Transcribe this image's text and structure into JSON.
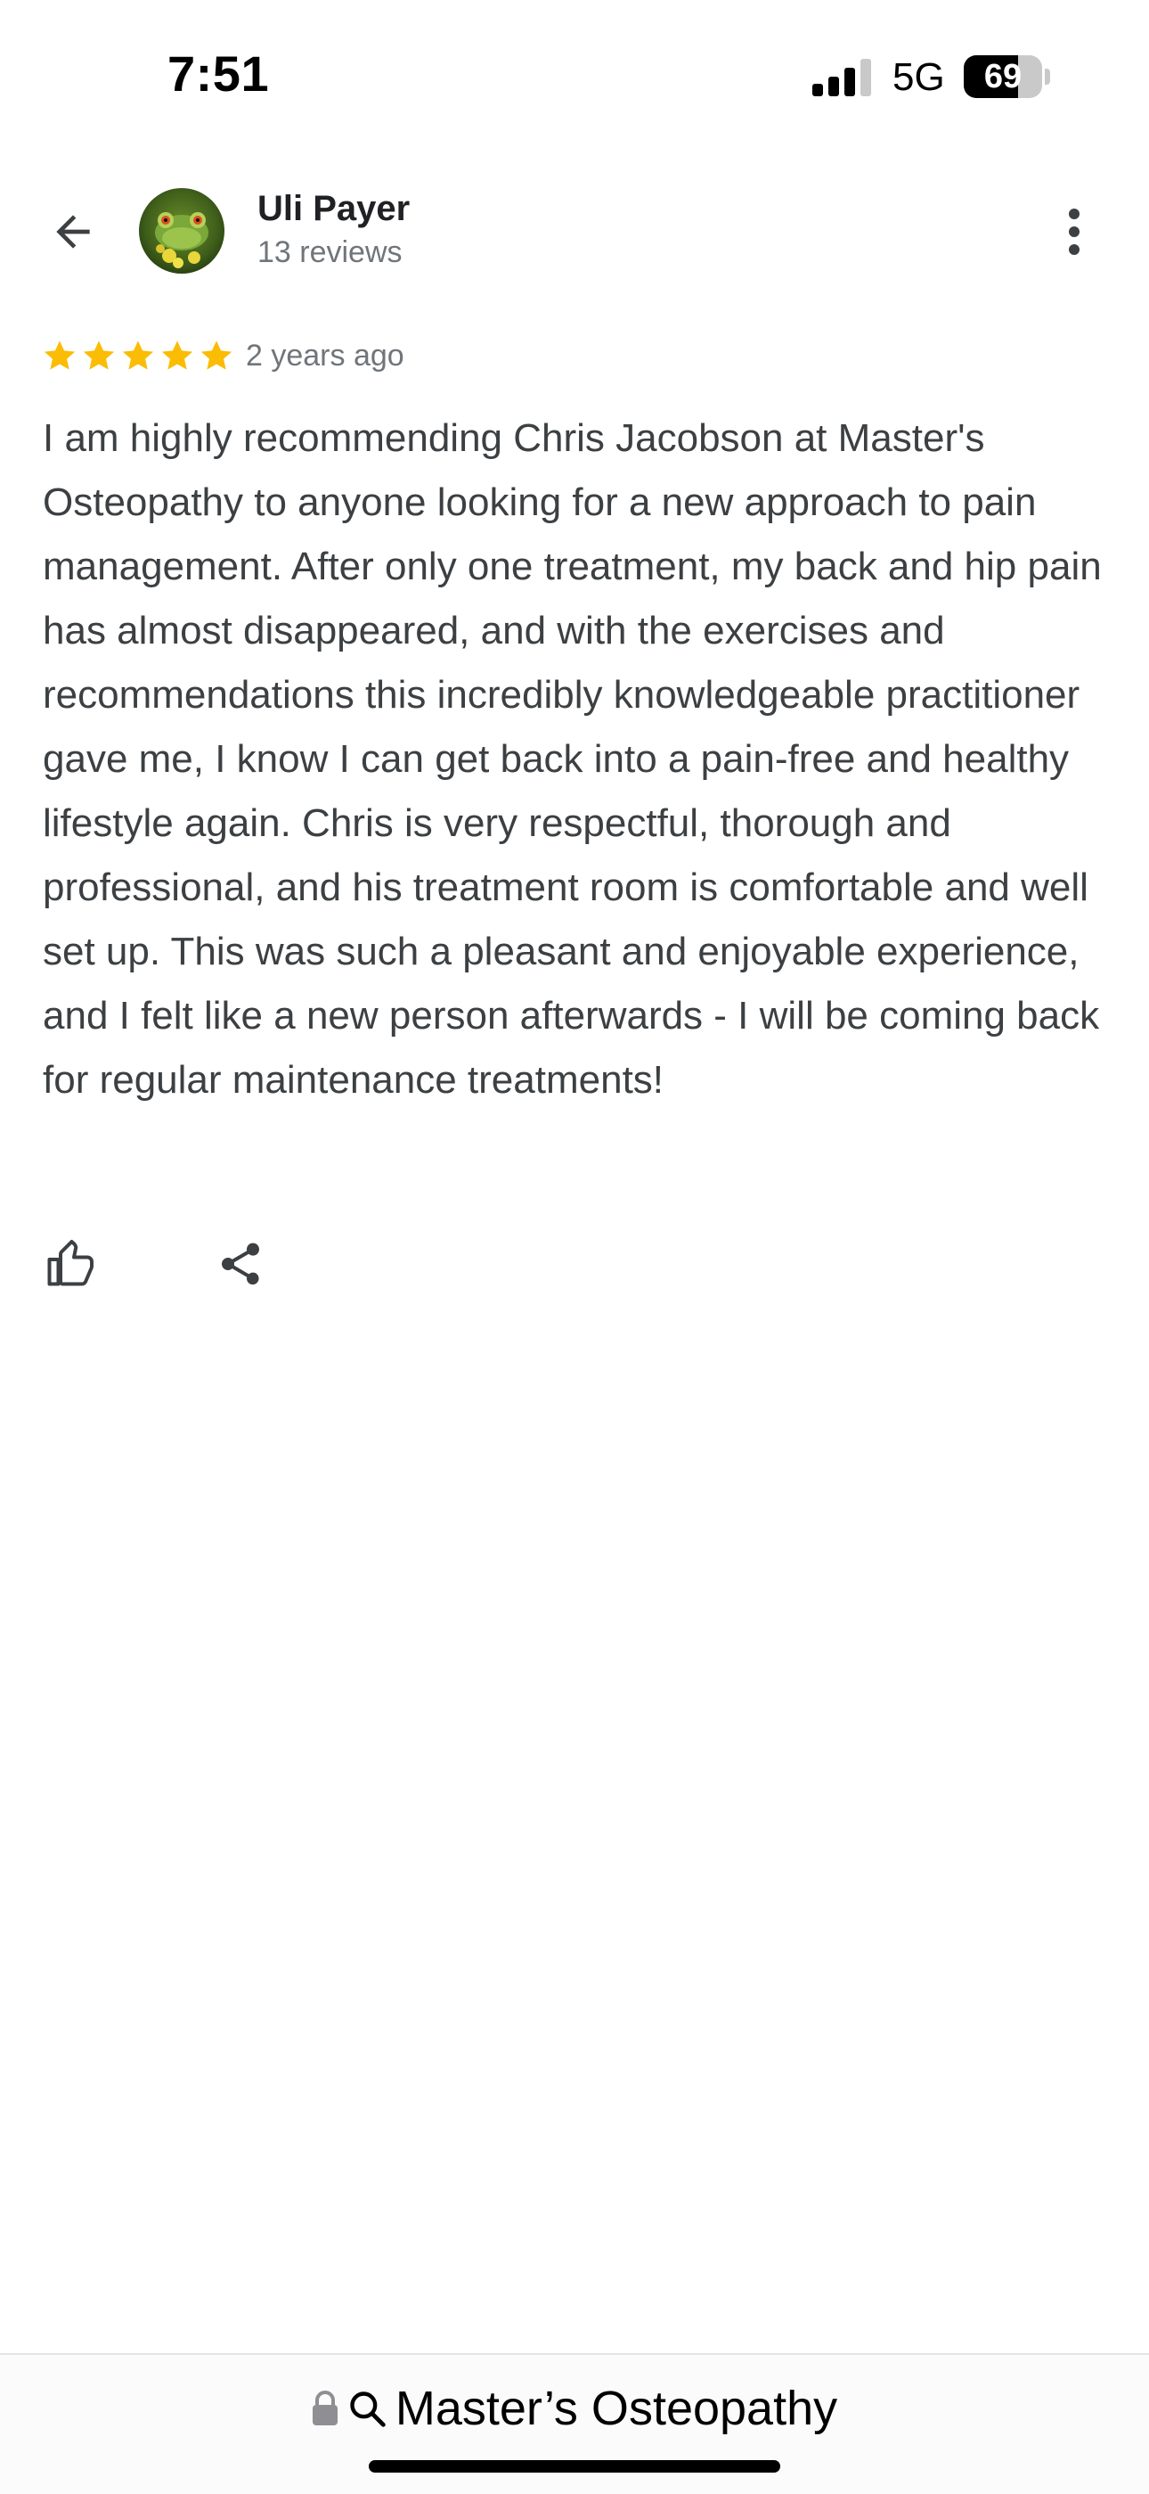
{
  "status_bar": {
    "time": "7:51",
    "network": "5G",
    "battery_level": "69",
    "battery_fraction": 0.69,
    "signal_bars_active": 3,
    "signal_bars_total": 4
  },
  "header": {
    "back_icon": "arrow-left-icon",
    "reviewer_name": "Uli Payer",
    "review_count": "13 reviews",
    "more_icon": "more-vertical-icon"
  },
  "review": {
    "rating": 5,
    "rating_max": 5,
    "date": "2 years ago",
    "text": "I am highly recommending Chris Jacobson at Master's Osteopathy to anyone looking for a new approach to pain management. After only one treatment, my back and hip pain has almost disappeared, and with the exercises and recommendations this incredibly knowledgeable practitioner gave me, I know I can get back into a pain-free and healthy lifestyle again. Chris is very respectful, thorough and professional, and his treatment room is comfortable and well set up. This was such a pleasant and enjoyable experience, and I felt like a new person afterwards - I will be coming back for regular maintenance treatments!"
  },
  "actions": {
    "like_icon": "thumbs-up-icon",
    "share_icon": "share-icon"
  },
  "browser_bar": {
    "url": "Master’s Osteopathy",
    "lock_icon": "lock-icon",
    "search_icon": "search-icon"
  },
  "colors": {
    "star": "#fbbc04",
    "secondary_text": "#70757a",
    "body_text": "#3c4043",
    "name_text": "#202124"
  }
}
